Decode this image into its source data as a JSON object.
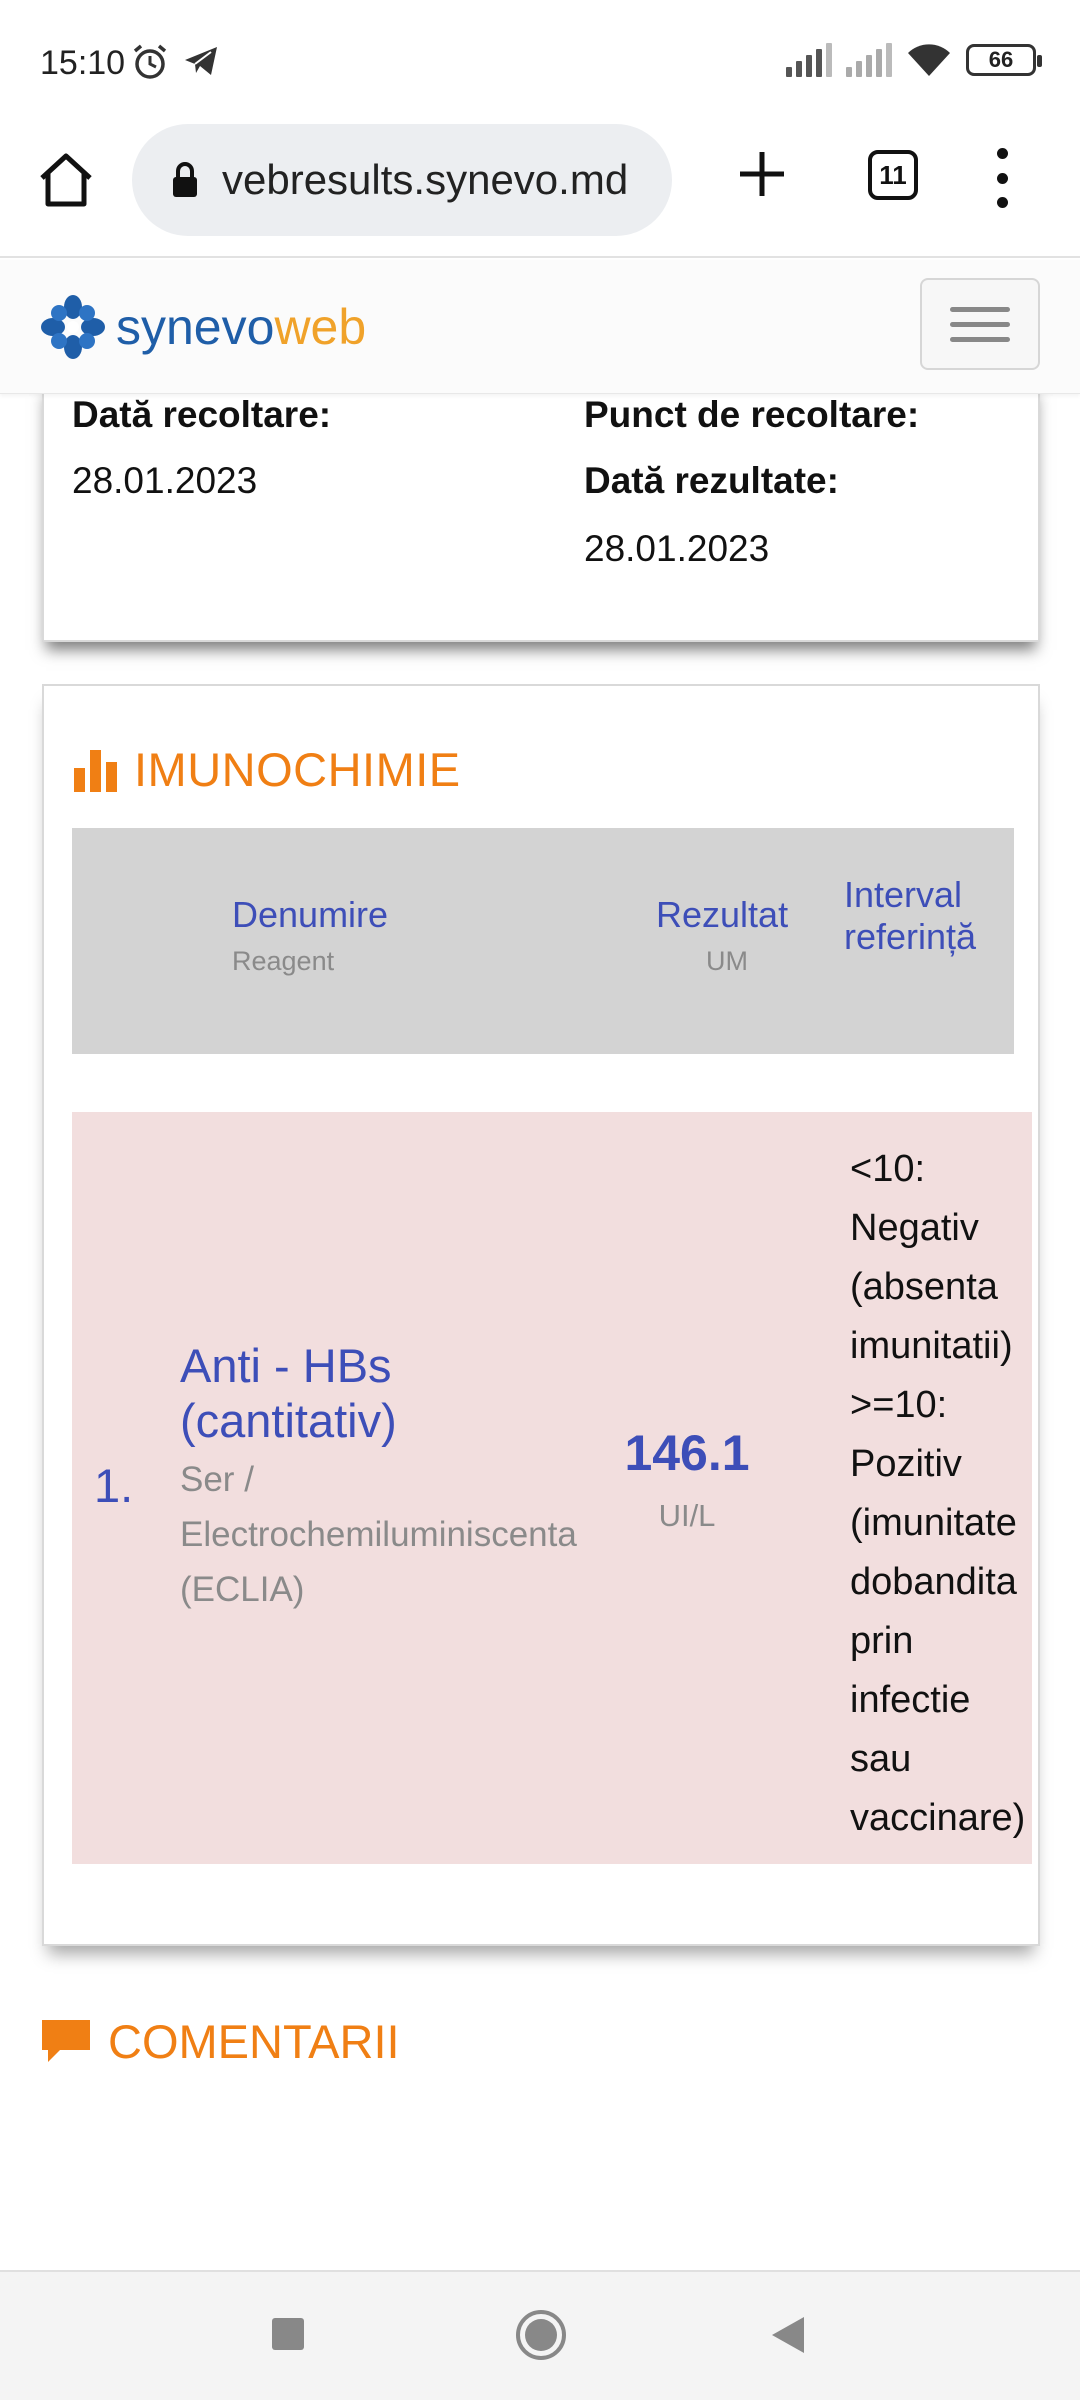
{
  "status_bar": {
    "time": "15:10",
    "battery": "66"
  },
  "browser": {
    "url": "vebresults.synevo.md",
    "tab_count": "11"
  },
  "site_header": {
    "logo_part1": "synevo",
    "logo_part2": "web"
  },
  "info_card": {
    "date_collected_label": "Dată recoltare:",
    "date_collected_value": "28.01.2023",
    "collection_point_label": "Punct de recoltare:",
    "date_results_label": "Dată rezultate:",
    "date_results_value": "28.01.2023"
  },
  "results_section": {
    "title": "IMUNOCHIMIE",
    "headers": {
      "name": "Denumire",
      "name_sub": "Reagent",
      "result": "Rezultat",
      "result_sub": "UM",
      "ref_line1": "Interval",
      "ref_line2": "referință"
    },
    "rows": [
      {
        "index": "1.",
        "name_line1": "Anti - HBs",
        "name_line2": "(cantitativ)",
        "method_line1": "Ser /",
        "method_line2": "Electrochemiluminiscenta",
        "method_line3": "(ECLIA)",
        "value": "146.1",
        "unit": "UI/L",
        "reference": [
          "<10:",
          "Negativ",
          "(absenta",
          "imunitatii)",
          ">=10:",
          "Pozitiv",
          "(imunitate",
          "dobandita",
          "prin",
          "infectie",
          "sau",
          "vaccinare)"
        ]
      }
    ]
  },
  "comments_section": {
    "title": "COMENTARII"
  },
  "colors": {
    "accent_orange": "#f07f14",
    "link_blue": "#3d4eb8",
    "abnormal_row": "#f2dede"
  }
}
